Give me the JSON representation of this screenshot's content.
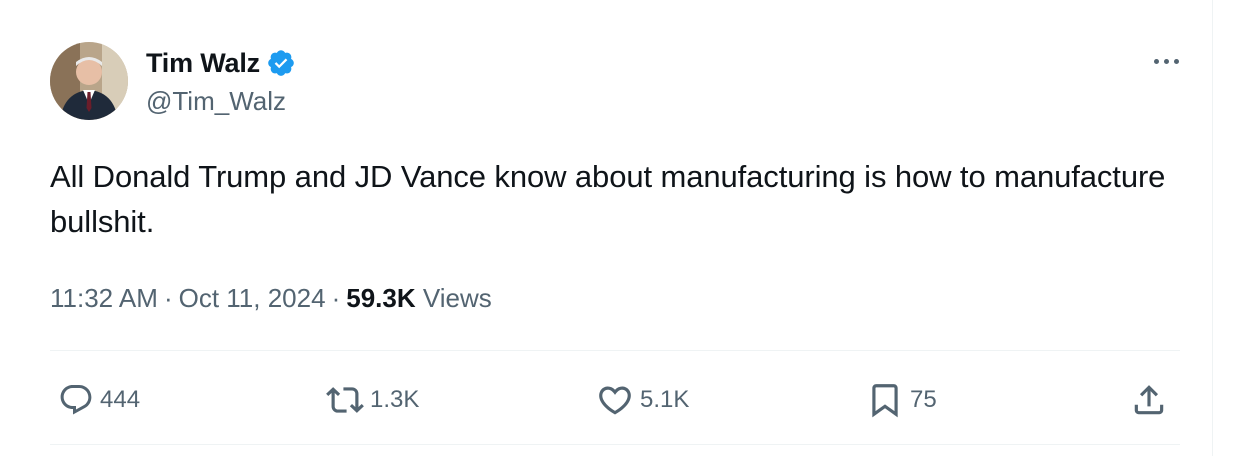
{
  "author": {
    "display_name": "Tim Walz",
    "handle": "@Tim_Walz",
    "verified": true
  },
  "tweet": {
    "text": "All Donald Trump and JD Vance know about manufacturing is how to manufacture bullshit."
  },
  "meta": {
    "time": "11:32 AM",
    "separator": "·",
    "date": "Oct 11, 2024",
    "views_count": "59.3K",
    "views_label": "Views"
  },
  "actions": {
    "reply_count": "444",
    "repost_count": "1.3K",
    "like_count": "5.1K",
    "bookmark_count": "75"
  },
  "icons": {
    "more": "more-icon",
    "verified": "verified-badge-icon",
    "reply": "reply-icon",
    "repost": "repost-icon",
    "like": "heart-icon",
    "bookmark": "bookmark-icon",
    "share": "share-icon"
  },
  "colors": {
    "text": "#0f1419",
    "secondary": "#536471",
    "verified": "#1d9bf0",
    "divider": "#eff3f4"
  }
}
